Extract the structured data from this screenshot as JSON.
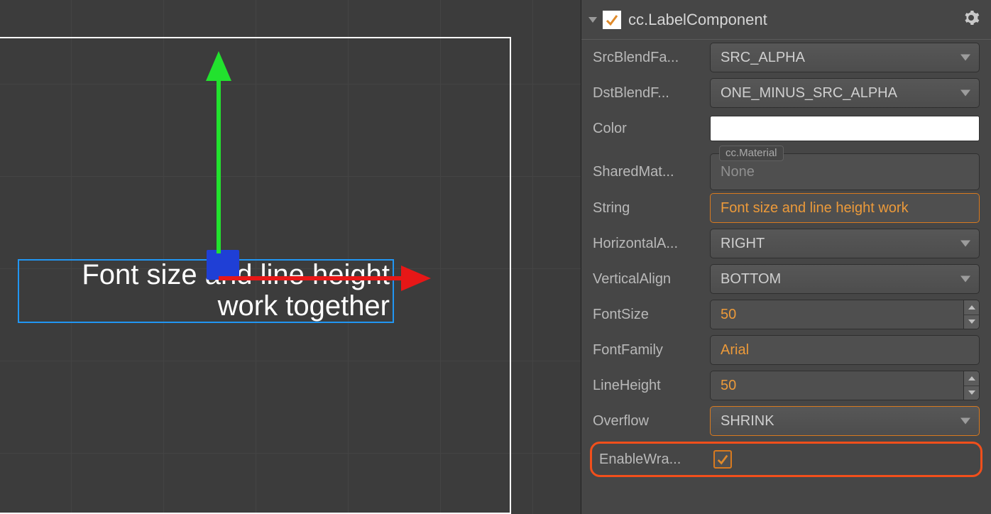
{
  "viewport": {
    "label_text": "Font size and line height\nwork together"
  },
  "component": {
    "title": "cc.LabelComponent",
    "enabled": true
  },
  "props": {
    "srcBlend": {
      "label": "SrcBlendFa...",
      "value": "SRC_ALPHA"
    },
    "dstBlend": {
      "label": "DstBlendF...",
      "value": "ONE_MINUS_SRC_ALPHA"
    },
    "color": {
      "label": "Color",
      "value": "#ffffff"
    },
    "sharedMat": {
      "label": "SharedMat...",
      "tag": "cc.Material",
      "placeholder": "None"
    },
    "string": {
      "label": "String",
      "value": "Font size and line height work"
    },
    "hAlign": {
      "label": "HorizontalA...",
      "value": "RIGHT"
    },
    "vAlign": {
      "label": "VerticalAlign",
      "value": "BOTTOM"
    },
    "fontSize": {
      "label": "FontSize",
      "value": "50"
    },
    "fontFamily": {
      "label": "FontFamily",
      "value": "Arial"
    },
    "lineHeight": {
      "label": "LineHeight",
      "value": "50"
    },
    "overflow": {
      "label": "Overflow",
      "value": "SHRINK"
    },
    "enableWrap": {
      "label": "EnableWra...",
      "checked": true
    }
  }
}
